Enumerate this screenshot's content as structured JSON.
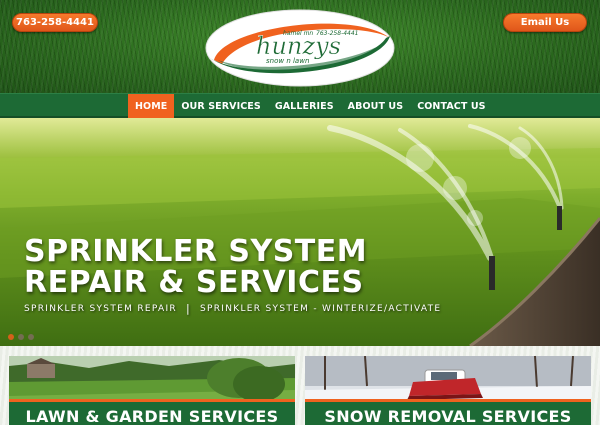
{
  "header": {
    "phone": "763-258-4441",
    "email_button": "Email Us",
    "logo": {
      "brand": "hunzys",
      "tagline": "snow n lawn",
      "location": "hamel mn",
      "phone": "763-258-4441"
    }
  },
  "nav": {
    "items": [
      {
        "label": "HOME",
        "active": true
      },
      {
        "label": "OUR SERVICES",
        "active": false
      },
      {
        "label": "GALLERIES",
        "active": false
      },
      {
        "label": "ABOUT US",
        "active": false
      },
      {
        "label": "CONTACT US",
        "active": false
      }
    ]
  },
  "hero": {
    "title_line1": "SPRINKLER SYSTEM",
    "title_line2": "REPAIR & SERVICES",
    "subtitle_left": "SPRINKLER SYSTEM REPAIR",
    "subtitle_separator": "|",
    "subtitle_right": "SPRINKLER SYSTEM - WINTERIZE/ACTIVATE",
    "slides": [
      true,
      false,
      false
    ]
  },
  "cards": {
    "lawn": "LAWN & GARDEN SERVICES",
    "snow": "SNOW REMOVAL SERVICES"
  },
  "colors": {
    "accent_orange": "#f0621f",
    "nav_green": "#1d6a35",
    "grass_green": "#2b6a1e"
  }
}
